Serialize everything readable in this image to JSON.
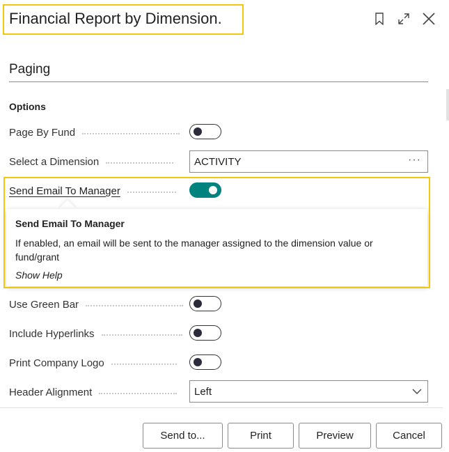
{
  "header": {
    "title": "Financial Report by Dimension.",
    "icons": [
      "bookmark-icon",
      "expand-icon",
      "close-icon"
    ]
  },
  "section": {
    "title": "Paging",
    "group": "Options"
  },
  "rows": {
    "page_by_fund": {
      "label": "Page By Fund",
      "value": false
    },
    "select_dimension": {
      "label": "Select a Dimension",
      "value": "ACTIVITY"
    },
    "send_email": {
      "label": "Send Email To Manager",
      "value": true
    },
    "use_green_bar": {
      "label": "Use Green Bar",
      "value": false
    },
    "include_hyperlinks": {
      "label": "Include Hyperlinks",
      "value": false
    },
    "print_company_logo": {
      "label": "Print Company Logo",
      "value": false
    },
    "header_alignment": {
      "label": "Header Alignment",
      "value": "Left"
    }
  },
  "tooltip": {
    "title": "Send Email To Manager",
    "body": "If enabled, an email will be sent to the manager assigned to the dimension value or fund/grant",
    "link": "Show Help"
  },
  "buttons": {
    "send_to": "Send to...",
    "print": "Print",
    "preview": "Preview",
    "cancel": "Cancel"
  },
  "colors": {
    "accent_teal": "#00827f",
    "highlight_yellow": "#f2c80f"
  }
}
